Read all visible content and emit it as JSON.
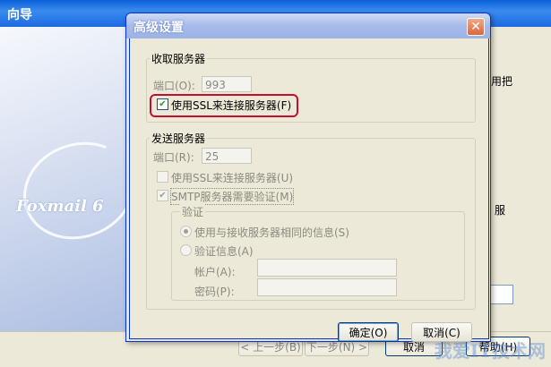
{
  "background": {
    "title": "向导",
    "logo": "Foxmail 6",
    "side_text_1": "用把",
    "side_text_2": "服",
    "buttons": {
      "prev": "< 上一步(B)",
      "next": "下一步(N) >",
      "cancel": "取消",
      "help": "帮助(H)"
    }
  },
  "dialog": {
    "title": "高级设置",
    "incoming": {
      "group_label": "收取服务器",
      "port_label": "端口(O):",
      "port_value": "993",
      "ssl_label": "使用SSL来连接服务器(F)",
      "ssl_checked": true
    },
    "outgoing": {
      "group_label": "发送服务器",
      "port_label": "端口(R):",
      "port_value": "25",
      "ssl_label": "使用SSL来连接服务器(U)",
      "ssl_checked": false,
      "smtp_auth_label": "SMTP服务器需要验证(M)",
      "smtp_auth_checked": true,
      "auth": {
        "group_label": "验证",
        "same_info_label": "使用与接收服务器相同的信息(S)",
        "custom_info_label": "验证信息(A)",
        "account_label": "帐户(A):",
        "account_value": "",
        "password_label": "密码(P):",
        "password_value": ""
      }
    },
    "ok_label": "确定(O)",
    "cancel_label": "取消(C)"
  },
  "watermark": "我爱IT技术网",
  "colors": {
    "highlight": "#c4102f",
    "title_bar": "#0a5fd8",
    "dialog_title": "#a7bbea"
  }
}
